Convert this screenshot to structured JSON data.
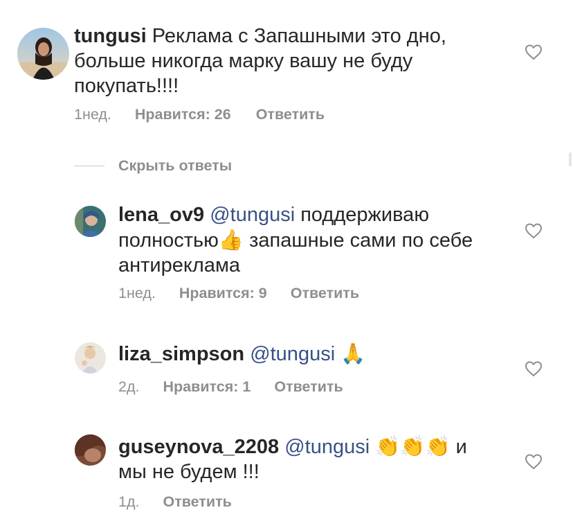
{
  "comments": [
    {
      "username": "tungusi",
      "text_lines": [
        "Реклама с Запашными это дно,",
        "больше никогда марку вашу не буду",
        "покупать!!!!"
      ],
      "time": "1нед.",
      "likes": "Нравится: 26",
      "reply": "Ответить"
    },
    {
      "username": "lena_ov9",
      "mention": "@tungusi",
      "text_part1": " поддерживаю",
      "text_part2": "полностью",
      "emoji_thumbs": "👍",
      "text_part3": " запашные сами по себе",
      "text_part4": "антиреклама",
      "time": "1нед.",
      "likes": "Нравится: 9",
      "reply": "Ответить"
    },
    {
      "username": "liza_simpson",
      "mention": "@tungusi",
      "emoji_pray": "🙏",
      "time": "2д.",
      "likes": "Нравится: 1",
      "reply": "Ответить"
    },
    {
      "username": "guseynova_2208",
      "mention": "@tungusi",
      "emoji_clap": "👏👏👏",
      "text_part1": " и",
      "text_part2": "мы не будем !!!",
      "time": "1д.",
      "reply": "Ответить"
    }
  ],
  "hide_replies": "Скрыть ответы",
  "icons": {
    "like": "heart-outline-icon"
  },
  "colors": {
    "text": "#262626",
    "meta": "#8e8e8e",
    "mention": "#385185"
  }
}
